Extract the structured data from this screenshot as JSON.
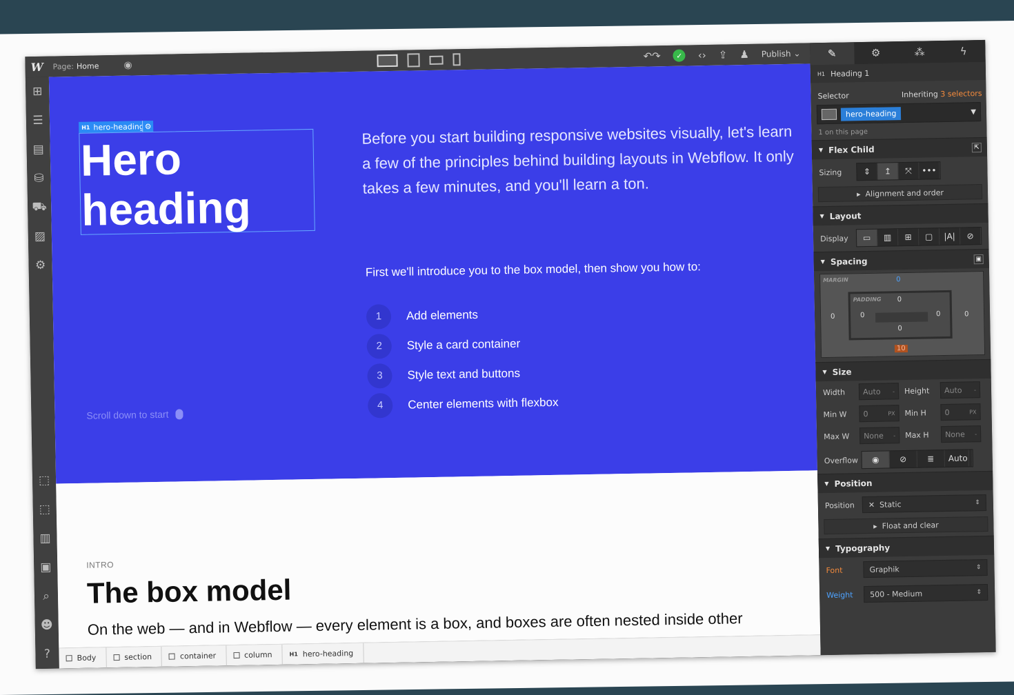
{
  "topbar": {
    "logo": "W",
    "page_label": "Page:",
    "page_name": "Home",
    "publish_label": "Publish"
  },
  "hero": {
    "selected_tag": "hero-heading",
    "heading_line1": "Hero",
    "heading_line2": "heading",
    "paragraph": "Before you start building responsive websites visually, let's learn a few of the principles behind building layouts in Webflow. It only takes a few minutes, and you'll learn a ton.",
    "intro_line": "First we'll introduce you to the box model, then show you how to:",
    "steps": [
      {
        "num": "1",
        "label": "Add elements"
      },
      {
        "num": "2",
        "label": "Style a card container"
      },
      {
        "num": "3",
        "label": "Style text and buttons"
      },
      {
        "num": "4",
        "label": "Center elements with flexbox"
      }
    ],
    "scroll_hint": "Scroll down to start"
  },
  "section2": {
    "eyebrow": "INTRO",
    "title": "The box model",
    "text": "On the web — and in Webflow — every element is a box, and boxes are often nested inside other"
  },
  "breadcrumbs": [
    "Body",
    "section",
    "container",
    "column",
    "hero-heading"
  ],
  "panel": {
    "element_tag": "H1",
    "element_name": "Heading 1",
    "selector_label": "Selector",
    "inheriting_label": "Inheriting",
    "inheriting_count": "3 selectors",
    "selector_chip": "hero-heading",
    "on_page": "1 on this page",
    "flex_child": "Flex Child",
    "sizing_label": "Sizing",
    "align_order": "Alignment and order",
    "layout": "Layout",
    "display_label": "Display",
    "spacing": "Spacing",
    "margin_label": "MARGIN",
    "padding_label": "PADDING",
    "margin": {
      "top": "0",
      "left": "0",
      "right": "0",
      "bottom": "10"
    },
    "padding": {
      "top": "0",
      "left": "0",
      "right": "0",
      "bottom": "0"
    },
    "size": "Size",
    "width_label": "Width",
    "width_val": "Auto",
    "height_label": "Height",
    "height_val": "Auto",
    "minw_label": "Min W",
    "minw_val": "0",
    "minh_label": "Min H",
    "minh_val": "0",
    "maxw_label": "Max W",
    "maxw_val": "None",
    "maxh_label": "Max H",
    "maxh_val": "None",
    "unit_px": "PX",
    "overflow_label": "Overflow",
    "overflow_auto": "Auto",
    "position": "Position",
    "position_label": "Position",
    "position_val": "Static",
    "float_clear": "Float and clear",
    "typography": "Typography",
    "font_label": "Font",
    "font_val": "Graphik",
    "weight_label": "Weight",
    "weight_val": "500 - Medium"
  },
  "colors": {
    "hero_bg": "#3b3ee8",
    "accent_blue": "#2b7fd9",
    "accent_orange": "#f28a3c",
    "publish_check": "#38b94a"
  }
}
